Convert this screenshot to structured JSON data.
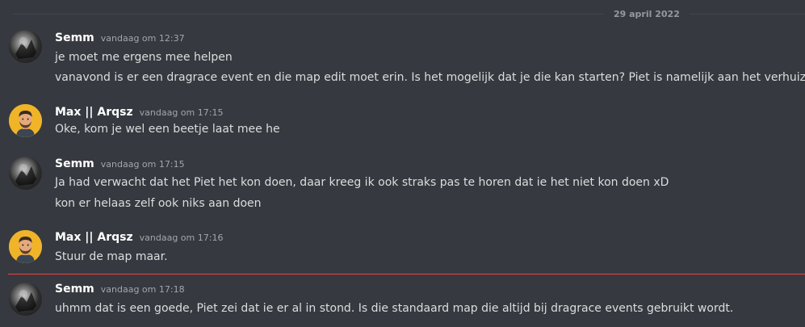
{
  "date_divider": "29 april 2022",
  "messages": [
    {
      "author": "Semm",
      "avatar_icon": "semm-avatar-icon",
      "timestamp": "vandaag om 12:37",
      "lines": [
        "je moet me ergens mee helpen",
        "vanavond is er een dragrace event en die map edit moet erin. Is het mogelijk dat je die kan starten? Piet is namelijk aan het verhuizen ofz"
      ]
    },
    {
      "author": "Max || Arqsz",
      "avatar_icon": "max-avatar-icon",
      "timestamp": "vandaag om 17:15",
      "lines": [
        "Oke, kom je wel een beetje laat mee he"
      ]
    },
    {
      "author": "Semm",
      "avatar_icon": "semm-avatar-icon",
      "timestamp": "vandaag om 17:15",
      "lines": [
        "Ja had verwacht dat het Piet het kon doen, daar kreeg ik ook straks pas te horen dat ie het niet kon doen xD",
        "kon er helaas zelf ook niks aan doen"
      ]
    },
    {
      "author": "Max || Arqsz",
      "avatar_icon": "max-avatar-icon",
      "timestamp": "vandaag om 17:16",
      "lines": [
        "Stuur de map maar."
      ]
    },
    {
      "author": "Semm",
      "avatar_icon": "semm-avatar-icon",
      "timestamp": "vandaag om 17:18",
      "lines": [
        "uhmm dat is een goede, Piet zei dat ie er al in stond. Is die standaard map die altijd bij dragrace events gebruikt wordt."
      ]
    }
  ],
  "colors": {
    "background": "#36393f",
    "username": "#ffffff",
    "message_text": "#dcddde",
    "timestamp": "#a3a6aa",
    "new_messages_divider": "#ed4245"
  }
}
